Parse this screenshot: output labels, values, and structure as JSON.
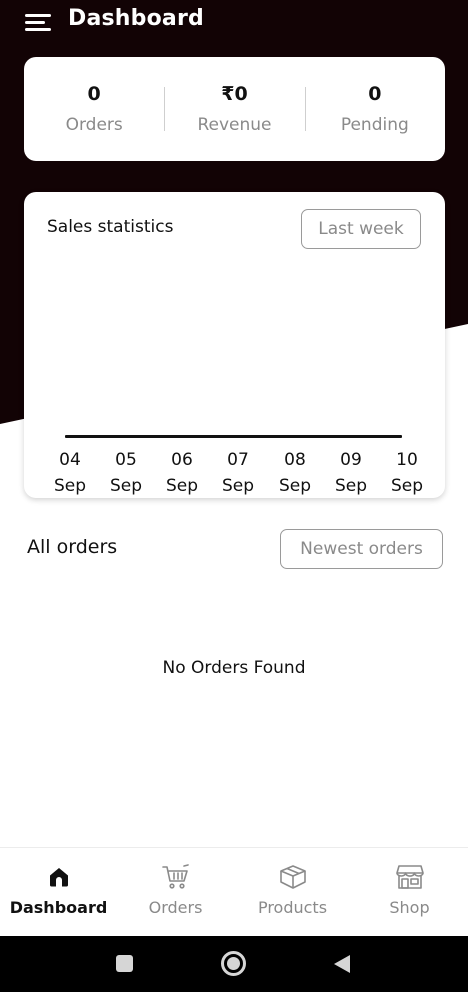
{
  "header": {
    "title": "Dashboard"
  },
  "stats": [
    {
      "value": "0",
      "label": "Orders"
    },
    {
      "value": "₹0",
      "label": "Revenue"
    },
    {
      "value": "0",
      "label": "Pending"
    }
  ],
  "sales": {
    "title": "Sales statistics",
    "range_label": "Last week",
    "days": [
      {
        "d": "04",
        "m": "Sep"
      },
      {
        "d": "05",
        "m": "Sep"
      },
      {
        "d": "06",
        "m": "Sep"
      },
      {
        "d": "07",
        "m": "Sep"
      },
      {
        "d": "08",
        "m": "Sep"
      },
      {
        "d": "09",
        "m": "Sep"
      },
      {
        "d": "10",
        "m": "Sep"
      }
    ]
  },
  "orders": {
    "title": "All orders",
    "sort_label": "Newest orders",
    "empty_message": "No Orders Found"
  },
  "nav": {
    "items": [
      {
        "label": "Dashboard",
        "icon": "home-icon",
        "active": true
      },
      {
        "label": "Orders",
        "icon": "cart-icon",
        "active": false
      },
      {
        "label": "Products",
        "icon": "box-icon",
        "active": false
      },
      {
        "label": "Shop",
        "icon": "store-icon",
        "active": false
      }
    ]
  },
  "colors": {
    "header_bg": "#120305",
    "accent_text": "#111111",
    "muted_text": "#8a8a8a"
  }
}
